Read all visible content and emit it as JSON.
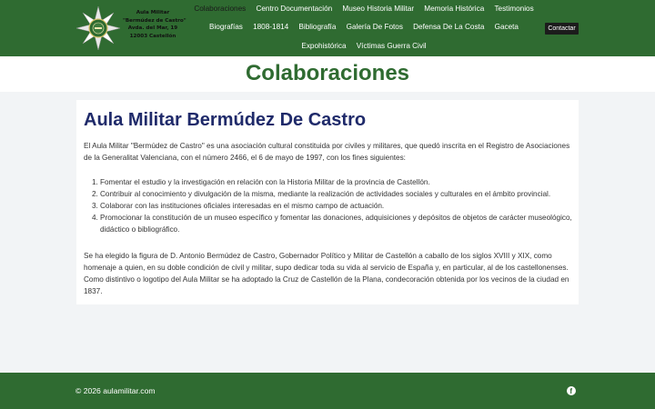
{
  "logo": {
    "lines": [
      "Aula Militar",
      "\"Bermúdez de Castro\"",
      "Avda. del Mar, 19",
      "12003 Castellón"
    ],
    "icon": "cross-of-castellon-icon"
  },
  "nav": {
    "row1": [
      "Colaboraciones",
      "Centro Documentación",
      "Museo Historia Militar",
      "Memoria Histórica",
      "Testimonios"
    ],
    "row2": [
      "Biografías",
      "1808-1814",
      "Bibliografía",
      "Galería De Fotos",
      "Defensa De La Costa",
      "Gaceta"
    ],
    "row3": [
      "Expohistórica",
      "Víctimas Guerra Civil"
    ],
    "active": "Colaboraciones"
  },
  "contact_label": "Contactar",
  "page_title": "Colaboraciones",
  "article": {
    "title": "Aula Militar Bermúdez De Castro",
    "intro": "El Aula Militar \"Bermúdez de Castro\" es una asociación cultural constituida por civiles y militares, que quedó inscrita en el Registro de Asociaciones de la Generalitat Valenciana, con el número 2466, el 6 de mayo de 1997, con los fines siguientes:",
    "aims": [
      "Fomentar el estudio y la investigación en relación con la Historia Militar de la provincia de Castellón.",
      "Contribuir al conocimiento y divulgación de la misma, mediante la realización de actividades sociales y culturales en el ámbito provincial.",
      "Colaborar con las instituciones oficiales interesadas en el mismo campo de actuación.",
      "Promocionar la constitución de un museo específico y fomentar las donaciones, adquisiciones y depósitos de objetos de carácter museológico, didáctico o bibliográfico."
    ],
    "closing": "Se ha elegido la figura de D. Antonio Bermúdez de Castro, Gobernador Político y Militar de Castellón a caballo de los siglos XVIII y XIX, como homenaje a quien, en su doble condición de civil y militar, supo dedicar toda su vida al servicio de España y, en particular, al de los castellonenses. Como distintivo o logotipo del Aula Militar se ha adoptado la Cruz de Castellón de la Plana, condecoración obtenida por los vecinos de la ciudad en 1837."
  },
  "footer": {
    "copyright": "© 2026 aulamilitar.com",
    "social_icon": "facebook-icon"
  },
  "colors": {
    "brand_green": "#2f6b31",
    "title_navy": "#1f2a6a",
    "contact_button": "#1c1c1c"
  }
}
